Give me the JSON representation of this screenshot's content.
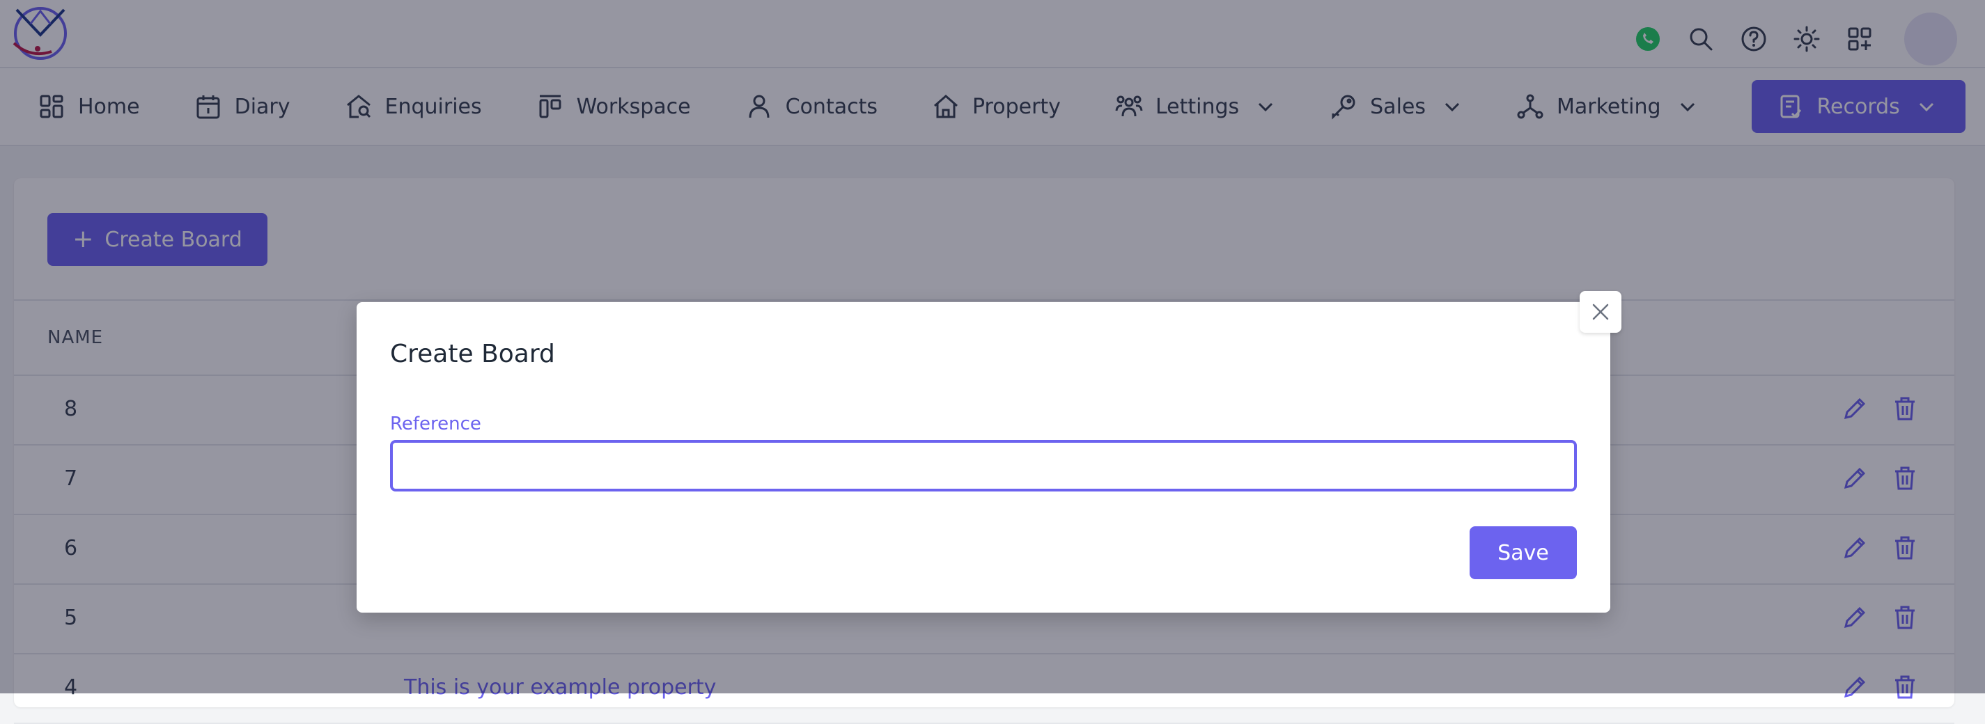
{
  "nav": {
    "items": [
      {
        "label": "Home",
        "icon": "home-grid-icon"
      },
      {
        "label": "Diary",
        "icon": "calendar-icon"
      },
      {
        "label": "Enquiries",
        "icon": "house-search-icon"
      },
      {
        "label": "Workspace",
        "icon": "workspace-icon"
      },
      {
        "label": "Contacts",
        "icon": "user-icon"
      },
      {
        "label": "Property",
        "icon": "house-icon"
      },
      {
        "label": "Lettings",
        "icon": "users-icon"
      },
      {
        "label": "Sales",
        "icon": "key-icon"
      },
      {
        "label": "Marketing",
        "icon": "network-icon"
      },
      {
        "label": "Records",
        "icon": "clipboard-check-icon"
      }
    ]
  },
  "toolbar": {
    "create_board_label": "Create Board"
  },
  "table": {
    "header": {
      "name": "NAME"
    },
    "rows": [
      {
        "name": "8",
        "description": ""
      },
      {
        "name": "7",
        "description": ""
      },
      {
        "name": "6",
        "description": ""
      },
      {
        "name": "5",
        "description": ""
      },
      {
        "name": "4",
        "description": "This is your example property"
      }
    ]
  },
  "modal": {
    "title": "Create Board",
    "reference_label": "Reference",
    "reference_value": "",
    "save_label": "Save"
  },
  "colors": {
    "accent": "#6c63ef",
    "whatsapp": "#25d366"
  }
}
